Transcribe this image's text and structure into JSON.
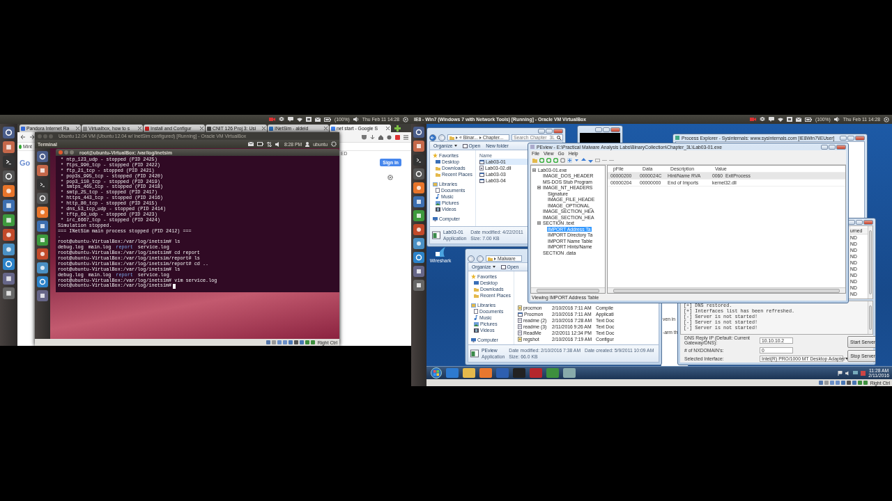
{
  "left_screen": {
    "top_bar": {
      "battery": "(100%)",
      "clock": "Thu Feb 11 14:28"
    },
    "browser": {
      "tabs": [
        {
          "label": "Pandora Internet Ra",
          "selected": false
        },
        {
          "label": "Virtualbox, how to s",
          "selected": false
        },
        {
          "label": "Install and Configur",
          "selected": false
        },
        {
          "label": "CNIT 126 Proj 3: Usi",
          "selected": false
        },
        {
          "label": "INetSim - aldeid",
          "selected": false
        },
        {
          "label": "net start - Google S",
          "selected": true
        }
      ],
      "bookmark": "Mint",
      "logo_fragment": "Go",
      "account_fragment": "ED",
      "sign_in": "Sign in"
    },
    "vm_window": {
      "title": "Ubuntu 12.04 VM (Ubuntu 12.04 w/ InetSim configured) [Running] - Oracle VM VirtualBox",
      "guest_panel": {
        "app": "Terminal",
        "time": "8:28 PM",
        "user": "ubuntu"
      },
      "terminal": {
        "title": "root@ubuntu-VirtualBox: /var/log/inetsim",
        "lines": [
          {
            "kind": "text",
            "text": " * ntp_123_udp - stopped (PID 2425)"
          },
          {
            "kind": "text",
            "text": " * ftps_990_tcp - stopped (PID 2422)"
          },
          {
            "kind": "text",
            "text": " * ftp_21_tcp - stopped (PID 2421)"
          },
          {
            "kind": "text",
            "text": " * pop3s_995_tcp - stopped (PID 2420)"
          },
          {
            "kind": "text",
            "text": " * pop3_110_tcp - stopped (PID 2419)"
          },
          {
            "kind": "text",
            "text": " * smtps_465_tcp - stopped (PID 2418)"
          },
          {
            "kind": "text",
            "text": " * smtp_25_tcp - stopped (PID 2417)"
          },
          {
            "kind": "text",
            "text": " * https_443_tcp - stopped (PID 2416)"
          },
          {
            "kind": "text",
            "text": " * http_80_tcp - stopped (PID 2415)"
          },
          {
            "kind": "text",
            "text": " * dns_53_tcp_udp - stopped (PID 2414)"
          },
          {
            "kind": "text",
            "text": " * tftp_69_udp - stopped (PID 2423)"
          },
          {
            "kind": "text",
            "text": " * irc_6667_tcp - stopped (PID 2424)"
          },
          {
            "kind": "text",
            "text": "Simulation stopped."
          },
          {
            "kind": "text",
            "text": "=== INetSim main process stopped (PID 2412) ==="
          },
          {
            "kind": "text",
            "text": "."
          },
          {
            "kind": "text",
            "text": "root@ubuntu-VirtualBox:/var/log/inetsim# ls"
          },
          {
            "kind": "listing",
            "items": [
              {
                "name": "debug.log",
                "dir": false
              },
              {
                "name": "main.log",
                "dir": false
              },
              {
                "name": "report",
                "dir": true
              },
              {
                "name": "service.log",
                "dir": false
              }
            ]
          },
          {
            "kind": "text",
            "text": "root@ubuntu-VirtualBox:/var/log/inetsim# cd report"
          },
          {
            "kind": "text",
            "text": "root@ubuntu-VirtualBox:/var/log/inetsim/report# ls"
          },
          {
            "kind": "text",
            "text": "root@ubuntu-VirtualBox:/var/log/inetsim/report# cd .."
          },
          {
            "kind": "text",
            "text": "root@ubuntu-VirtualBox:/var/log/inetsim# ls"
          },
          {
            "kind": "listing",
            "items": [
              {
                "name": "debug.log",
                "dir": false
              },
              {
                "name": "main.log",
                "dir": false
              },
              {
                "name": "report",
                "dir": true
              },
              {
                "name": "service.log",
                "dir": false
              }
            ]
          },
          {
            "kind": "text",
            "text": "root@ubuntu-VirtualBox:/var/log/inetsim# vim service.log"
          },
          {
            "kind": "prompt",
            "text": "root@ubuntu-VirtualBox:/var/log/inetsim#"
          }
        ]
      },
      "host_key": "Right Ctrl"
    }
  },
  "right_screen": {
    "top_bar": {
      "title": "IE8 - Win7 (Windows 7 with Network Tools) [Running] - Oracle VM VirtualBox",
      "battery": "(100%)",
      "clock": "Thu Feb 11 14:28"
    },
    "explorer_back": {
      "path": [
        "« Binar...",
        "Chapter..."
      ],
      "search_placeholder": "Search Chapter_3L",
      "toolbar": [
        {
          "label": "Organize",
          "kind": "menu"
        },
        {
          "label": "Open",
          "kind": "open"
        },
        {
          "label": "New folder",
          "kind": "plain"
        }
      ],
      "nav": [
        {
          "label": "Favorites",
          "kind": "star"
        },
        {
          "label": "Desktop",
          "kind": "desktop"
        },
        {
          "label": "Downloads",
          "kind": "folder"
        },
        {
          "label": "Recent Places",
          "kind": "folder"
        },
        {
          "label": "Libraries",
          "kind": "library"
        },
        {
          "label": "Documents",
          "kind": "document"
        },
        {
          "label": "Music",
          "kind": "music"
        },
        {
          "label": "Pictures",
          "kind": "picture"
        },
        {
          "label": "Videos",
          "kind": "video"
        },
        {
          "label": "Computer",
          "kind": "computer"
        }
      ],
      "column": "Name",
      "files": [
        {
          "cells": [
            "Lab03-01"
          ],
          "kind": "exe",
          "selected": true
        },
        {
          "cells": [
            "Lab03-02.dll"
          ],
          "kind": "dll",
          "selected": false
        },
        {
          "cells": [
            "Lab03-03"
          ],
          "kind": "exe",
          "selected": false
        },
        {
          "cells": [
            "Lab03-04"
          ],
          "kind": "exe",
          "selected": false
        }
      ],
      "details": {
        "name": "Lab03-01",
        "type": "Application",
        "fields": [
          "Date modified: 4/22/2011",
          "Size: 7.00 KB"
        ]
      }
    },
    "process_explorer": {
      "title": "Process Explorer - Sysinternals: www.sysinternals.com [IE8Win7\\IEUser]"
    },
    "partial_window": {
      "lines": [
        "ven in",
        "-arm th"
      ]
    },
    "dns_tool": {
      "column_header": "urned",
      "rows": [
        "ND",
        "ND",
        "ND",
        "ND",
        "ND",
        "ND",
        "ND",
        "ND",
        "ND",
        "ND"
      ],
      "log": [
        "[+] DNS restored.",
        "[+] Interfaces list has been refreshed.",
        "[-] Server is not started!",
        "[-] Server is not started!",
        "[-] Server is not started!"
      ],
      "fields": [
        {
          "label": "DNS Reply IP (Default: Current Gateway/DNS):",
          "value": "10.10.10.2",
          "kind": "text"
        },
        {
          "label": "# of NXDOMAIN's:",
          "value": "0",
          "kind": "text"
        },
        {
          "label": "Selected Interface:",
          "value": "Intel(R) PRO/1000 MT Desktop Adapter",
          "kind": "select"
        }
      ],
      "buttons": [
        "Start Server",
        "Stop Server"
      ]
    },
    "explorer_front": {
      "path": [
        "Malware"
      ],
      "toolbar": [
        {
          "label": "Organize",
          "kind": "menu"
        },
        {
          "label": "Open",
          "kind": "open"
        }
      ],
      "nav": [
        {
          "label": "Favorites",
          "kind": "star"
        },
        {
          "label": "Desktop",
          "kind": "desktop"
        },
        {
          "label": "Downloads",
          "kind": "folder"
        },
        {
          "label": "Recent Places",
          "kind": "folder"
        },
        {
          "label": "Libraries",
          "kind": "library"
        },
        {
          "label": "Documents",
          "kind": "document"
        },
        {
          "label": "Music",
          "kind": "music"
        },
        {
          "label": "Pictures",
          "kind": "picture"
        },
        {
          "label": "Videos",
          "kind": "video"
        },
        {
          "label": "Computer",
          "kind": "computer"
        }
      ],
      "files": [
        {
          "cells": [
            "procmon",
            "2/10/2016 7:11 AM",
            "Compile"
          ],
          "kind": "config",
          "selected": false
        },
        {
          "cells": [
            "Procmon",
            "2/10/2016 7:11 AM",
            "Applicati"
          ],
          "kind": "exe",
          "selected": false
        },
        {
          "cells": [
            "readme (2)",
            "2/10/2016 7:28 AM",
            "Text Doc"
          ],
          "kind": "text",
          "selected": false
        },
        {
          "cells": [
            "readme (3)",
            "2/11/2016 9:26 AM",
            "Text Doc"
          ],
          "kind": "text",
          "selected": false
        },
        {
          "cells": [
            "ReadMe",
            "2/2/2011 12:34 PM",
            "Text Doc"
          ],
          "kind": "text",
          "selected": false
        },
        {
          "cells": [
            "regshot",
            "2/10/2016 7:19 AM",
            "Configur"
          ],
          "kind": "config",
          "selected": false
        }
      ],
      "details": {
        "name": "PEview",
        "type": "Application",
        "fields": [
          "Date modified: 2/10/2016 7:38 AM",
          "Size: 66.0 KB",
          "Date created: 5/9/2011 10:09 AM"
        ]
      }
    },
    "peview": {
      "title": "PEview - E:\\Practical Malware Analysis Labs\\BinaryCollection\\Chapter_3L\\Lab03-01.exe",
      "menu": [
        "File",
        "View",
        "Go",
        "Help"
      ],
      "tree": [
        {
          "label": "Lab03-01.exe",
          "selected": false,
          "expanded": true,
          "children": [
            {
              "label": "IMAGE_DOS_HEADER",
              "selected": false
            },
            {
              "label": "MS-DOS Stub Program",
              "selected": false
            },
            {
              "label": "IMAGE_NT_HEADERS",
              "selected": false,
              "expanded": true,
              "children": [
                {
                  "label": "Signature",
                  "selected": false
                },
                {
                  "label": "IMAGE_FILE_HEADE",
                  "selected": false
                },
                {
                  "label": "IMAGE_OPTIONAL_",
                  "selected": false
                }
              ]
            },
            {
              "label": "IMAGE_SECTION_HEA",
              "selected": false
            },
            {
              "label": "IMAGE_SECTION_HEA",
              "selected": false
            },
            {
              "label": "SECTION .text",
              "selected": false,
              "expanded": true,
              "children": [
                {
                  "label": "IMPORT Address Ta",
                  "selected": true
                },
                {
                  "label": "IMPORT Directory Ta",
                  "selected": false
                },
                {
                  "label": "IMPORT Name Table",
                  "selected": false
                },
                {
                  "label": "IMPORT Hints/Name",
                  "selected": false
                }
              ]
            },
            {
              "label": "SECTION .data",
              "selected": false
            }
          ]
        }
      ],
      "columns": [
        "pFile",
        "Data",
        "Description",
        "Value"
      ],
      "rows": [
        {
          "cells": [
            "00000200",
            "0000024C",
            "Hint/Name RVA",
            "0060  ExitProcess"
          ],
          "selected": true
        },
        {
          "cells": [
            "00000204",
            "00000000",
            "End of Imports",
            "kernel32.dll"
          ],
          "selected": false
        }
      ],
      "status": "Viewing IMPORT Address Table"
    },
    "desktop_icons": [
      {
        "label": "Wireshark"
      }
    ],
    "taskbar": {
      "time": "11:28 AM",
      "date": "2/11/2016"
    },
    "host_key": "Right Ctrl"
  }
}
